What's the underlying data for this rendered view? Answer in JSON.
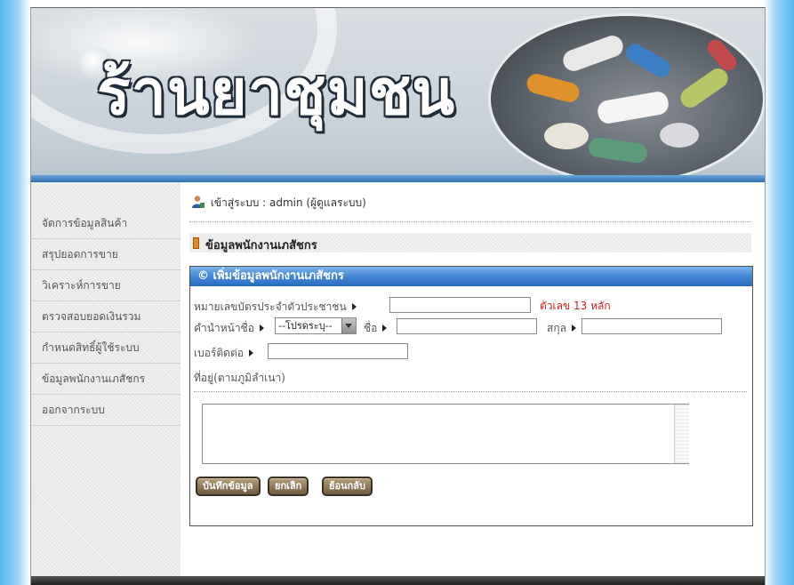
{
  "banner": {
    "title": "ร้านยาชุมชน"
  },
  "sidebar": {
    "items": [
      {
        "label": "จัดการข้อมูลสินค้า"
      },
      {
        "label": "สรุปยอดการขาย"
      },
      {
        "label": "วิเคราะห์การขาย"
      },
      {
        "label": "ตรวจสอบยอดเงินรวม"
      },
      {
        "label": "กำหนดสิทธิ์ผู้ใช้ระบบ"
      },
      {
        "label": "ข้อมูลพนักงานเภสัชกร"
      },
      {
        "label": "ออกจากระบบ"
      }
    ]
  },
  "main": {
    "login_text": "เข้าสู่ระบบ : admin (ผู้ดูแลระบบ)",
    "section_title": "ข้อมูลพนักงานเภสัชกร",
    "panel_title": "© เพิ่มข้อมูลพนักงานเภสัชกร"
  },
  "form": {
    "id_label": "หมายเลขบัตรประจำตัวประชาชน",
    "id_hint": "ตัวเลข 13 หลัก",
    "id_value": "",
    "prefix_label": "คำนำหน้าชื่อ",
    "prefix_selected": "--โปรดระบุ--",
    "name_label": "ชื่อ",
    "name_value": "",
    "surname_label": "สกุล",
    "surname_value": "",
    "phone_label": "เบอร์ติดต่อ",
    "phone_value": "",
    "address_label": "ที่อยู่(ตามภูมิลำเนา)",
    "address_value": ""
  },
  "buttons": {
    "save": "บันทึกข้อมูล",
    "cancel": "ยกเลิก",
    "back": "ย้อนกลับ"
  },
  "colors": {
    "panel_header": "#3f83d3",
    "hint_red": "#d21c1c",
    "button": "#6e5a3c"
  }
}
